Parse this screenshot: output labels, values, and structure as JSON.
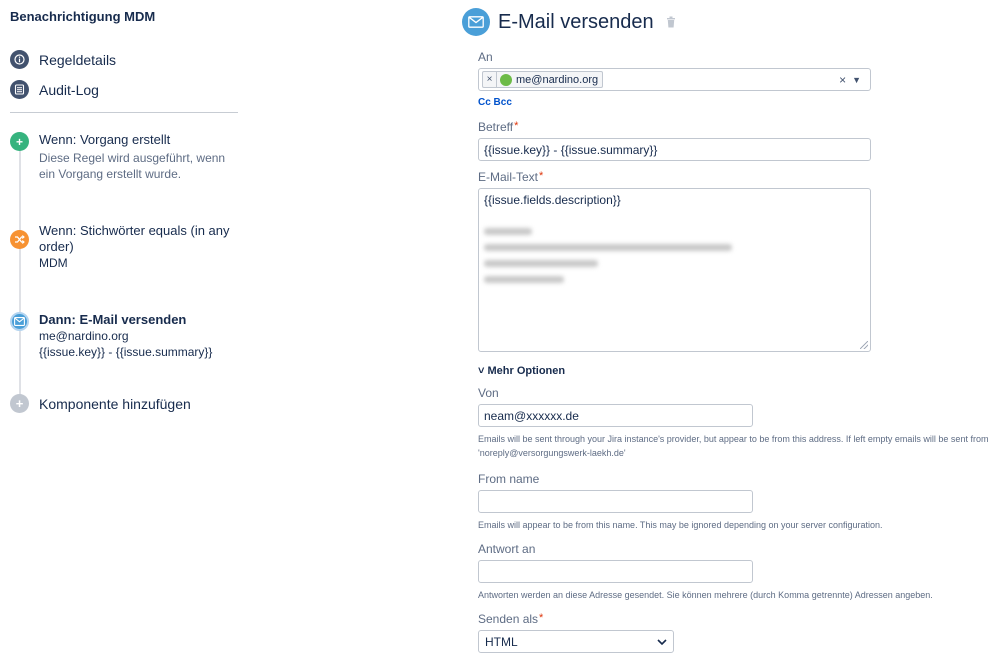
{
  "sidebar": {
    "rule_title": "Benachrichtigung MDM",
    "items": [
      {
        "label": "Regeldetails"
      },
      {
        "label": "Audit-Log"
      }
    ],
    "steps": [
      {
        "title": "Wenn: Vorgang erstellt",
        "desc": "Diese Regel wird ausgeführt, wenn ein Vorgang erstellt wurde."
      },
      {
        "title": "Wenn: Stichwörter equals (in any order)",
        "desc": "MDM"
      },
      {
        "title": "Dann: E-Mail versenden",
        "desc_line1": "me@nardino.org",
        "desc_line2": "{{issue.key}} - {{issue.summary}}"
      }
    ],
    "add_component": "Komponente hinzufügen"
  },
  "form": {
    "title": "E-Mail versenden",
    "to_label": "An",
    "to_chip": "me@nardino.org",
    "cc_bcc": "Cc Bcc",
    "subject_label": "Betreff",
    "subject_value": "{{issue.key}} - {{issue.summary}}",
    "body_label": "E-Mail-Text",
    "body_value": "{{issue.fields.description}}",
    "more_options": "Mehr Optionen",
    "from_label": "Von",
    "from_value": "neam@xxxxxx.de",
    "from_help": "Emails will be sent through your Jira instance's provider, but appear to be from this address. If left empty emails will be sent from 'noreply@versorgungswerk-laekh.de'",
    "from_name_label": "From name",
    "from_name_value": "",
    "from_name_help": "Emails will appear to be from this name. This may be ignored depending on your server configuration.",
    "reply_label": "Antwort an",
    "reply_value": "",
    "reply_help": "Antworten werden an diese Adresse gesendet. Sie können mehrere (durch Komma getrennte) Adressen angeben.",
    "send_as_label": "Senden als",
    "send_as_value": "HTML"
  },
  "colors": {
    "email_icon": "#4a9fd8",
    "trigger_icon": "#36b37e",
    "condition_icon": "#f79232",
    "required": "#de350b",
    "link": "#0052cc"
  },
  "icons": {
    "rule_details": "info-icon",
    "audit_log": "list-icon",
    "trigger": "plus-icon",
    "condition": "shuffle-icon",
    "action": "envelope-icon",
    "add": "plus-icon",
    "delete": "trash-icon"
  }
}
